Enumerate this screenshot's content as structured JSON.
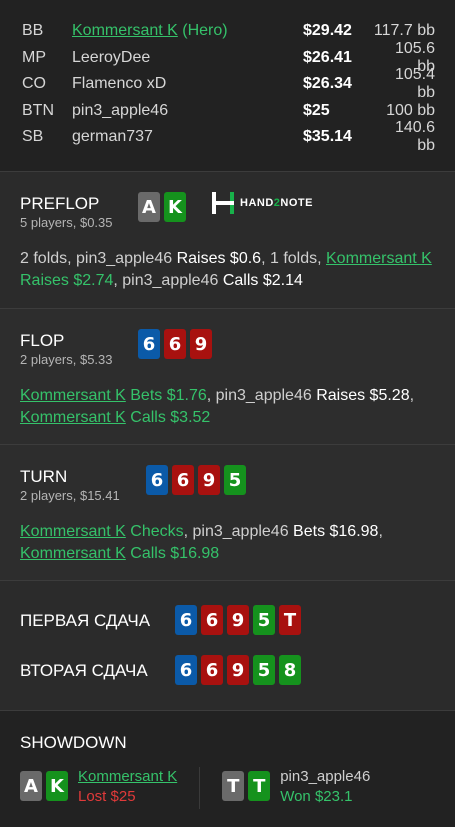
{
  "players": [
    {
      "pos": "BB",
      "name": "Kommersant K",
      "hero_tag": " (Hero)",
      "stack": "$29.42",
      "bb": "117.7 bb",
      "hero": true
    },
    {
      "pos": "MP",
      "name": "LeeroyDee",
      "hero_tag": "",
      "stack": "$26.41",
      "bb": "105.6 bb",
      "hero": false
    },
    {
      "pos": "CO",
      "name": "Flamenco xD",
      "hero_tag": "",
      "stack": "$26.34",
      "bb": "105.4 bb",
      "hero": false
    },
    {
      "pos": "BTN",
      "name": "pin3_apple46",
      "hero_tag": "",
      "stack": "$25",
      "bb": "100 bb",
      "hero": false
    },
    {
      "pos": "SB",
      "name": "german737",
      "hero_tag": "",
      "stack": "$35.14",
      "bb": "140.6 bb",
      "hero": false
    }
  ],
  "logo": {
    "pre": "HAND",
    "mid": "2",
    "post": "NOTE"
  },
  "preflop": {
    "name": "PREFLOP",
    "sub": "5 players, $0.35",
    "cards": [
      {
        "r": "A",
        "c": "grey"
      },
      {
        "r": "K",
        "c": "green"
      }
    ],
    "action": [
      {
        "t": "2 folds, pin3_apple46 ",
        "s": "n"
      },
      {
        "t": "Raises $0.6",
        "s": "w"
      },
      {
        "t": ", 1 folds, ",
        "s": "n"
      },
      {
        "t": "Kommersant K",
        "s": "hu"
      },
      {
        "t": " Raises $2.74",
        "s": "h"
      },
      {
        "t": ", pin3_apple46 ",
        "s": "n"
      },
      {
        "t": "Calls $2.14",
        "s": "w"
      }
    ]
  },
  "flop": {
    "name": "FLOP",
    "sub": "2 players, $5.33",
    "cards": [
      {
        "r": "6",
        "c": "blue"
      },
      {
        "r": "6",
        "c": "red"
      },
      {
        "r": "9",
        "c": "red"
      }
    ],
    "action": [
      {
        "t": "Kommersant K",
        "s": "hu"
      },
      {
        "t": " Bets $1.76",
        "s": "h"
      },
      {
        "t": ", pin3_apple46 ",
        "s": "n"
      },
      {
        "t": "Raises $5.28",
        "s": "w"
      },
      {
        "t": ", ",
        "s": "n"
      },
      {
        "t": "Kommersant K",
        "s": "hu"
      },
      {
        "t": " Calls $3.52",
        "s": "h"
      }
    ]
  },
  "turn": {
    "name": "TURN",
    "sub": "2 players, $15.41",
    "cards": [
      {
        "r": "6",
        "c": "blue"
      },
      {
        "r": "6",
        "c": "red"
      },
      {
        "r": "9",
        "c": "red"
      },
      {
        "r": "5",
        "c": "green"
      }
    ],
    "action": [
      {
        "t": "Kommersant K",
        "s": "hu"
      },
      {
        "t": " Checks",
        "s": "h"
      },
      {
        "t": ", pin3_apple46 ",
        "s": "n"
      },
      {
        "t": "Bets $16.98",
        "s": "w"
      },
      {
        "t": ", ",
        "s": "n"
      },
      {
        "t": "Kommersant K",
        "s": "hu"
      },
      {
        "t": " Calls $16.98",
        "s": "h"
      }
    ]
  },
  "runs": [
    {
      "label": "ПЕРВАЯ СДАЧА",
      "cards": [
        {
          "r": "6",
          "c": "blue"
        },
        {
          "r": "6",
          "c": "red"
        },
        {
          "r": "9",
          "c": "red"
        },
        {
          "r": "5",
          "c": "green"
        },
        {
          "r": "T",
          "c": "red"
        }
      ]
    },
    {
      "label": "ВТОРАЯ СДАЧА",
      "cards": [
        {
          "r": "6",
          "c": "blue"
        },
        {
          "r": "6",
          "c": "red"
        },
        {
          "r": "9",
          "c": "red"
        },
        {
          "r": "5",
          "c": "green"
        },
        {
          "r": "8",
          "c": "green"
        }
      ]
    }
  ],
  "showdown": {
    "title": "SHOWDOWN",
    "players": [
      {
        "name": "Kommersant K",
        "result": "Lost $25",
        "outcome": "lost",
        "hero": true,
        "cards": [
          {
            "r": "A",
            "c": "grey"
          },
          {
            "r": "K",
            "c": "green"
          }
        ]
      },
      {
        "name": "pin3_apple46",
        "result": "Won $23.1",
        "outcome": "won",
        "hero": false,
        "cards": [
          {
            "r": "T",
            "c": "grey"
          },
          {
            "r": "T",
            "c": "green"
          }
        ]
      }
    ]
  },
  "colors": {
    "hero": "#35c26a",
    "red": "#a8110f",
    "blue": "#0b5aa8",
    "green": "#15921d",
    "grey": "#6a6a6a",
    "lost": "#e03a3a"
  }
}
